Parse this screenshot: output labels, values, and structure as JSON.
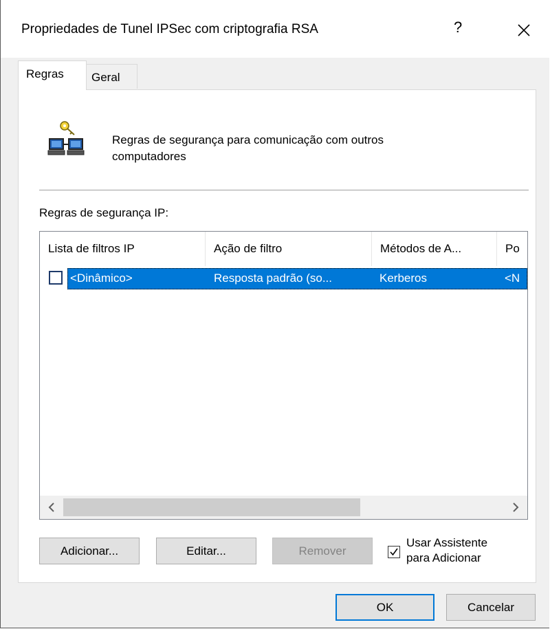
{
  "window": {
    "title": "Propriedades de Tunel IPSec com criptografia RSA",
    "help": "?",
    "close": "✕"
  },
  "tabs": [
    {
      "label": "Regras",
      "selected": true
    },
    {
      "label": "Geral",
      "selected": false
    }
  ],
  "header": {
    "icon": "networked-computers-key-icon",
    "description_line1": "Regras de segurança para comunicação com outros",
    "description_line2": "computadores"
  },
  "rules_label": "Regras de segurança IP:",
  "table": {
    "columns": [
      "Lista de filtros IP",
      "Ação de filtro",
      "Métodos de A...",
      "Po"
    ],
    "rows": [
      {
        "checked": false,
        "selected": true,
        "cells": [
          "<Dinâmico>",
          "Resposta padrão (so...",
          "Kerberos",
          "<N"
        ]
      }
    ]
  },
  "buttons": {
    "add": "Adicionar...",
    "edit": "Editar...",
    "remove": "Remover",
    "ok": "OK",
    "cancel": "Cancelar"
  },
  "wizard": {
    "checked": true,
    "label_line1": "Usar Assistente",
    "label_line2": "para Adicionar"
  },
  "colors": {
    "selection": "#0078d7",
    "dialog_bg": "#f0f0f0"
  }
}
